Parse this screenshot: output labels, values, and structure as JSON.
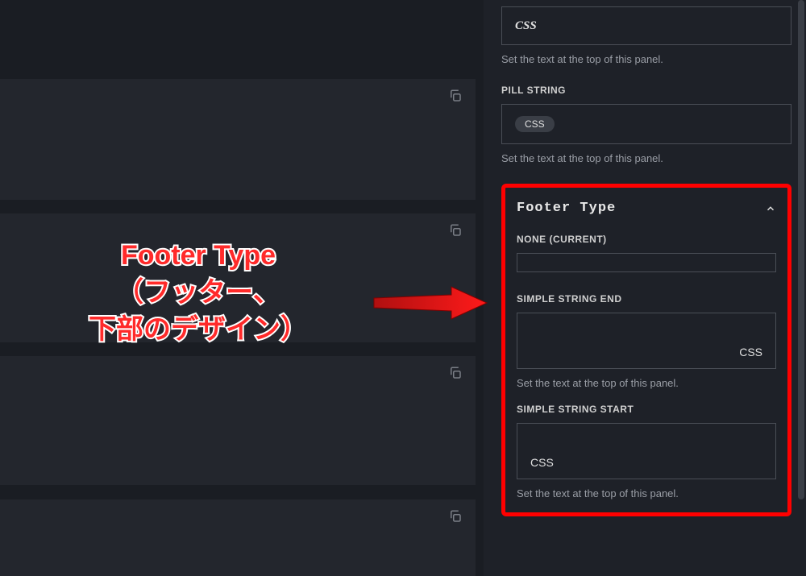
{
  "top_sections": {
    "css_field_value": "CSS",
    "css_help": "Set the text at the top of this panel.",
    "pill_label": "PILL STRING",
    "pill_value": "CSS",
    "pill_help": "Set the text at the top of this panel."
  },
  "footer": {
    "title": "Footer Type",
    "none_label": "NONE (CURRENT)",
    "simple_end_label": "SIMPLE STRING END",
    "simple_end_value": "CSS",
    "simple_end_help": "Set the text at the top of this panel.",
    "simple_start_label": "SIMPLE STRING START",
    "simple_start_value": "CSS",
    "simple_start_help": "Set the text at the top of this panel."
  },
  "annotation": {
    "line1": "Footer Type",
    "line2": "（フッター、",
    "line3": "下部のデザイン）"
  }
}
